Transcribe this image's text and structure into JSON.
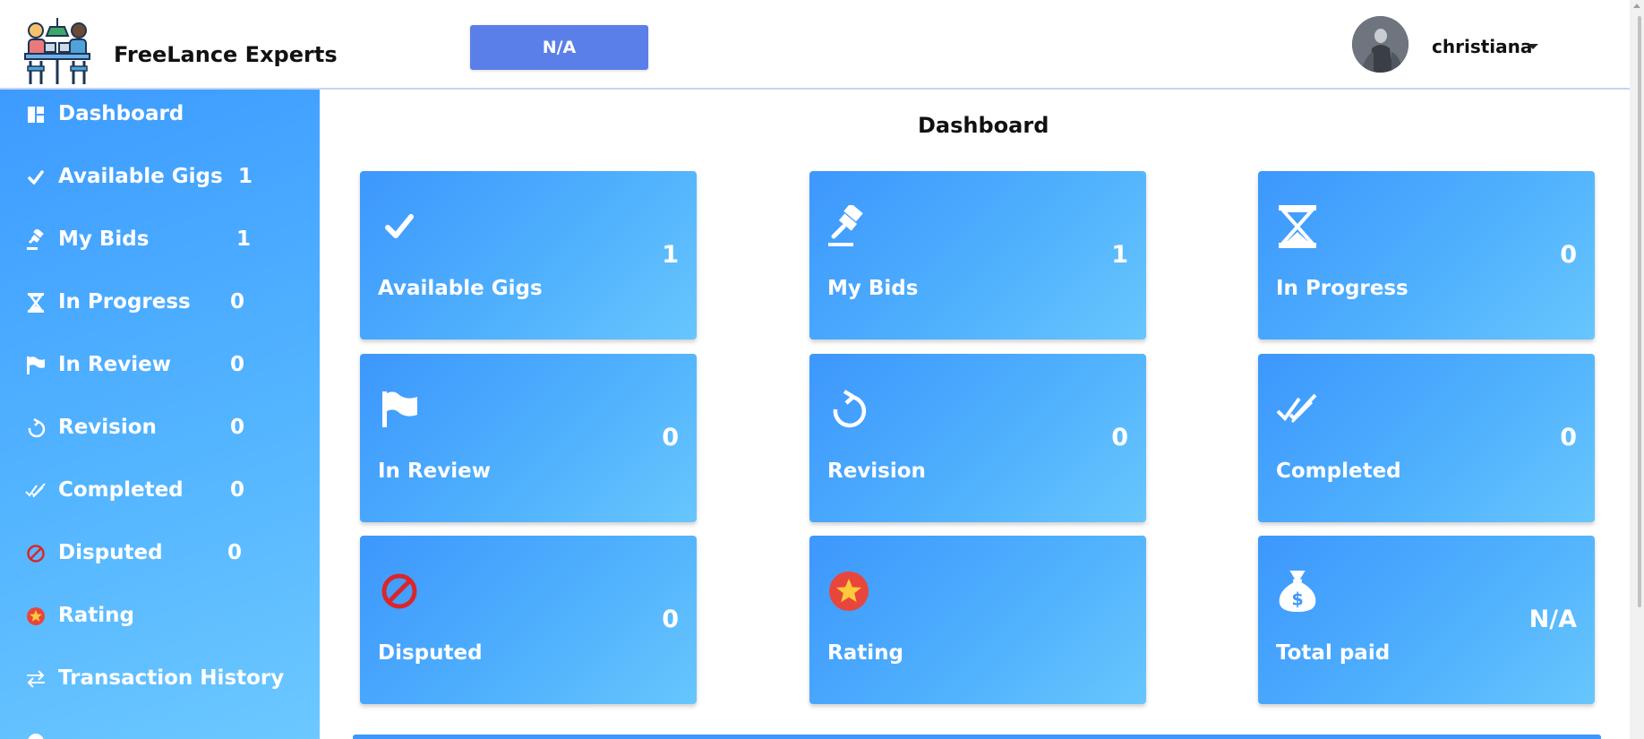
{
  "header": {
    "brand": "FreeLance Experts",
    "status_button": "N/A",
    "username": "christiana"
  },
  "sidebar": {
    "items": [
      {
        "label": "Dashboard",
        "count": "",
        "icon": "dashboard-icon"
      },
      {
        "label": "Available Gigs",
        "count": "1",
        "icon": "check-icon"
      },
      {
        "label": "My Bids",
        "count": "1",
        "icon": "gavel-icon"
      },
      {
        "label": "In Progress",
        "count": "0",
        "icon": "hourglass-icon"
      },
      {
        "label": "In Review",
        "count": "0",
        "icon": "flag-icon"
      },
      {
        "label": "Revision",
        "count": "0",
        "icon": "refresh-icon"
      },
      {
        "label": "Completed",
        "count": "0",
        "icon": "double-check-icon"
      },
      {
        "label": "Disputed",
        "count": "0",
        "icon": "ban-icon"
      },
      {
        "label": "Rating",
        "count": "",
        "icon": "star-badge-icon"
      },
      {
        "label": "Transaction History",
        "count": "",
        "icon": "exchange-icon"
      }
    ]
  },
  "main": {
    "title": "Dashboard",
    "cards": [
      {
        "label": "Available Gigs",
        "value": "1",
        "icon": "check-icon"
      },
      {
        "label": "My Bids",
        "value": "1",
        "icon": "gavel-icon"
      },
      {
        "label": "In Progress",
        "value": "0",
        "icon": "hourglass-icon"
      },
      {
        "label": "In Review",
        "value": "0",
        "icon": "flag-icon"
      },
      {
        "label": "Revision",
        "value": "0",
        "icon": "refresh-icon"
      },
      {
        "label": "Completed",
        "value": "0",
        "icon": "double-check-icon"
      },
      {
        "label": "Disputed",
        "value": "0",
        "icon": "ban-icon"
      },
      {
        "label": "Rating",
        "value": "",
        "icon": "star-badge-icon"
      },
      {
        "label": "Total paid",
        "value": "N/A",
        "icon": "money-bag-icon"
      }
    ]
  },
  "colors": {
    "accent": "#3d97fd",
    "button": "#5b7fe8",
    "disputed": "#d9262b",
    "rating_badge": "#e8463c",
    "rating_star": "#ffc93c"
  }
}
